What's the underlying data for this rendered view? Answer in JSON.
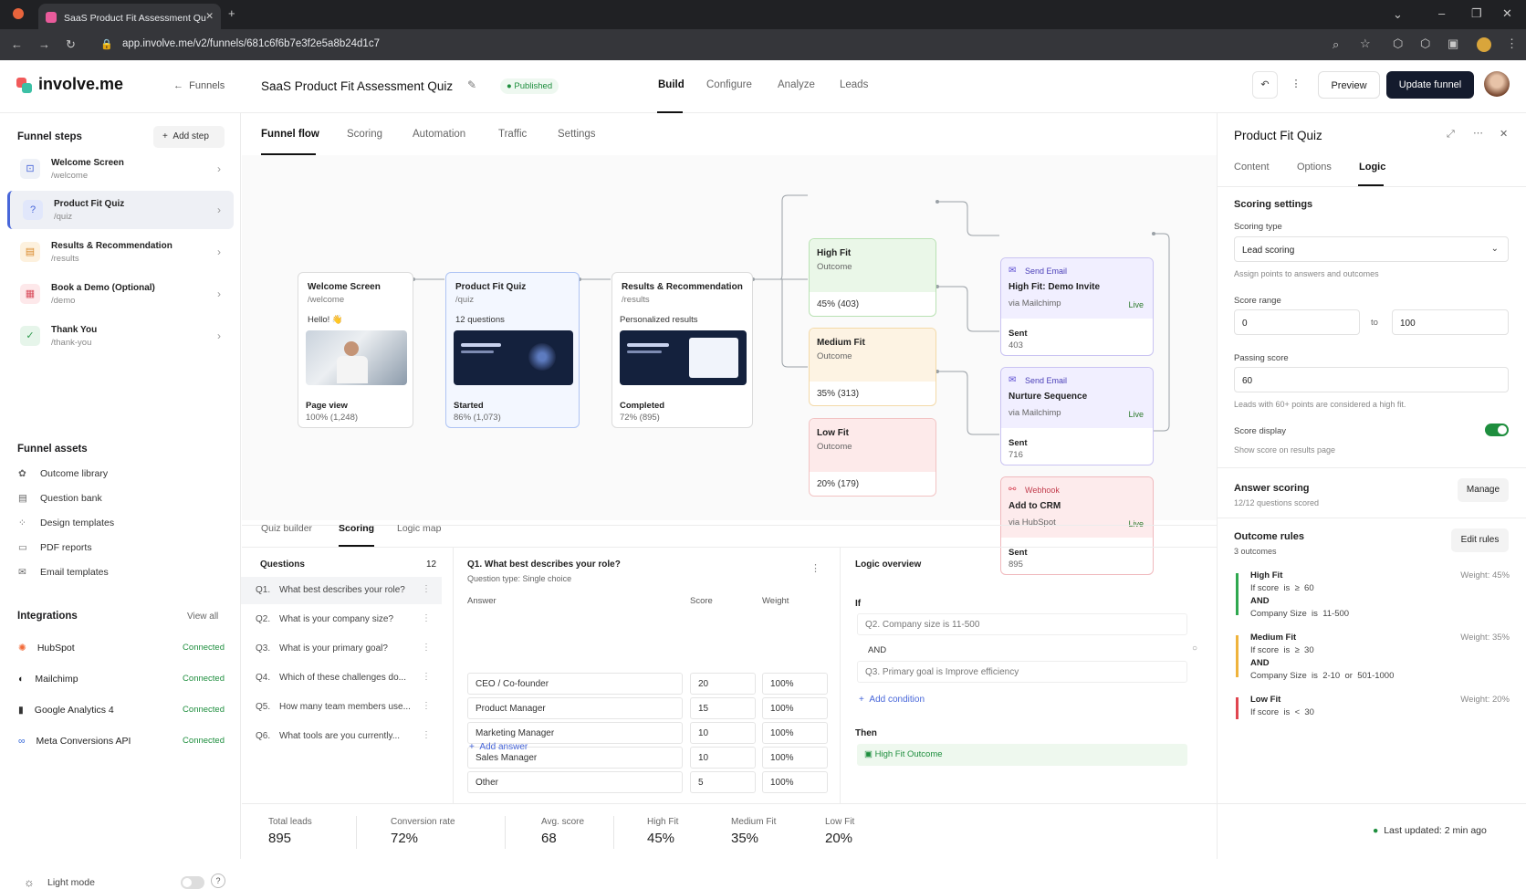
{
  "browser": {
    "tab_title": "SaaS Product Fit Assessment Qu",
    "url": "app.involve.me/v2/funnels/681c6f6b7e3f2e5a8b24d1c7"
  },
  "header": {
    "logo": "involve.me",
    "back_label": "Funnels",
    "title": "SaaS Product Fit Assessment Quiz",
    "status": "Published",
    "nav": [
      "Build",
      "Configure",
      "Analyze",
      "Leads"
    ],
    "preview": "Preview",
    "update": "Update funnel"
  },
  "sidebar": {
    "steps_title": "Funnel steps",
    "add_step": "Add step",
    "steps": [
      {
        "name": "Welcome Screen",
        "path": "/welcome"
      },
      {
        "name": "Product Fit Quiz",
        "path": "/quiz"
      },
      {
        "name": "Results & Recommendation",
        "path": "/results"
      },
      {
        "name": "Book a Demo (Optional)",
        "path": "/demo"
      },
      {
        "name": "Thank You",
        "path": "/thank-you"
      }
    ],
    "assets_title": "Funnel assets",
    "assets": [
      "Outcome library",
      "Question bank",
      "Design templates",
      "PDF reports",
      "Email templates"
    ],
    "integrations_title": "Integrations",
    "view_all": "View all",
    "integrations": [
      {
        "name": "HubSpot",
        "status": "Connected"
      },
      {
        "name": "Mailchimp",
        "status": "Connected"
      },
      {
        "name": "Google Analytics 4",
        "status": "Connected"
      },
      {
        "name": "Meta Conversions API",
        "status": "Connected"
      }
    ],
    "light_mode": "Light mode",
    "help": "?"
  },
  "subtabs": [
    "Funnel flow",
    "Scoring",
    "Automation",
    "Traffic",
    "Settings"
  ],
  "flow": {
    "welcome": {
      "title": "Welcome Screen",
      "path": "/welcome",
      "hello": "Hello! 👋",
      "metric_label": "Page view",
      "metric": "100% (1,248)"
    },
    "quiz": {
      "title": "Product Fit Quiz",
      "path": "/quiz",
      "sub": "12 questions",
      "metric_label": "Started",
      "metric": "86% (1,073)"
    },
    "results": {
      "title": "Results & Recommendation",
      "path": "/results",
      "sub": "Personalized results",
      "metric_label": "Completed",
      "metric": "72% (895)"
    },
    "outcomes": [
      {
        "title": "High Fit",
        "sub": "Outcome",
        "metric": "45% (403)"
      },
      {
        "title": "Medium Fit",
        "sub": "Outcome",
        "metric": "35% (313)"
      },
      {
        "title": "Low Fit",
        "sub": "Outcome",
        "metric": "20% (179)"
      }
    ],
    "actions": [
      {
        "kind": "Send Email",
        "title": "High Fit: Demo Invite",
        "via": "via Mailchimp",
        "live": "Live",
        "sent_label": "Sent",
        "sent": "403"
      },
      {
        "kind": "Send Email",
        "title": "Nurture Sequence",
        "via": "via Mailchimp",
        "live": "Live",
        "sent_label": "Sent",
        "sent": "716"
      },
      {
        "kind": "Webhook",
        "title": "Add to CRM",
        "via": "via HubSpot",
        "live": "Live",
        "sent_label": "Sent",
        "sent": "895"
      }
    ]
  },
  "bottom_tabs": [
    "Quiz builder",
    "Scoring",
    "Logic map"
  ],
  "questions": {
    "title": "Questions",
    "count": "12",
    "items": [
      {
        "num": "Q1.",
        "text": "What best describes your role?"
      },
      {
        "num": "Q2.",
        "text": "What is your company size?"
      },
      {
        "num": "Q3.",
        "text": "What is your primary goal?"
      },
      {
        "num": "Q4.",
        "text": "Which of these challenges do..."
      },
      {
        "num": "Q5.",
        "text": "How many team members use..."
      },
      {
        "num": "Q6.",
        "text": "What tools are you currently..."
      }
    ]
  },
  "question_detail": {
    "title": "Q1. What best describes your role?",
    "type": "Question type: Single choice",
    "cols": [
      "Answer",
      "Score",
      "Weight"
    ],
    "rows": [
      {
        "answer": "CEO / Co-founder",
        "score": "20",
        "weight": "100%"
      },
      {
        "answer": "Product Manager",
        "score": "15",
        "weight": "100%"
      },
      {
        "answer": "Marketing Manager",
        "score": "10",
        "weight": "100%"
      },
      {
        "answer": "Sales Manager",
        "score": "10",
        "weight": "100%"
      },
      {
        "answer": "Other",
        "score": "5",
        "weight": "100%"
      }
    ],
    "add": "Add answer"
  },
  "logic": {
    "title": "Logic overview",
    "if": "If",
    "c1": "Q2. Company size  is  11-500",
    "and": "AND",
    "c2": "Q3. Primary goal  is  Improve efficiency",
    "add": "Add condition",
    "then": "Then",
    "result": "High Fit Outcome"
  },
  "stats": [
    {
      "label": "Total leads",
      "value": "895"
    },
    {
      "label": "Conversion rate",
      "value": "72%"
    },
    {
      "label": "Avg. score",
      "value": "68"
    },
    {
      "label": "High Fit",
      "value": "45%"
    },
    {
      "label": "Medium Fit",
      "value": "35%"
    },
    {
      "label": "Low Fit",
      "value": "20%"
    }
  ],
  "updated": "Last updated: 2 min ago",
  "panel": {
    "title": "Product Fit Quiz",
    "tabs": [
      "Content",
      "Options",
      "Logic"
    ],
    "scoring_settings": "Scoring settings",
    "scoring_type_label": "Scoring type",
    "scoring_type": "Lead scoring",
    "scoring_hint": "Assign points to answers and outcomes",
    "range_label": "Score range",
    "range_min": "0",
    "range_to": "to",
    "range_max": "100",
    "passing_label": "Passing score",
    "passing": "60",
    "passing_hint": "Leads with 60+ points are considered a high fit.",
    "display_label": "Score display",
    "display_hint": "Show score on results page",
    "answer_scoring": "Answer scoring",
    "answer_scoring_sub": "12/12 questions scored",
    "manage": "Manage",
    "outcome_rules": "Outcome rules",
    "outcome_rules_sub": "3 outcomes",
    "edit_rules": "Edit rules",
    "rules": [
      {
        "name": "High Fit",
        "weight": "Weight: 45%",
        "l1": "If score  is  ≥  60",
        "l2": "AND",
        "l3": "Company Size  is  11-500"
      },
      {
        "name": "Medium Fit",
        "weight": "Weight: 35%",
        "l1": "If score  is  ≥  30",
        "l2": "AND",
        "l3": "Company Size  is  2-10  or  501-1000"
      },
      {
        "name": "Low Fit",
        "weight": "Weight: 20%",
        "l1": "If score  is  <  30",
        "l2": "",
        "l3": ""
      }
    ]
  },
  "colors": {
    "accent": "#4766d9",
    "green": "#1e8e3e",
    "high": "#eaf7e8",
    "medium": "#fdf3e3",
    "low": "#fdeaea",
    "email": "#f1efff",
    "webhook": "#fdebec"
  }
}
